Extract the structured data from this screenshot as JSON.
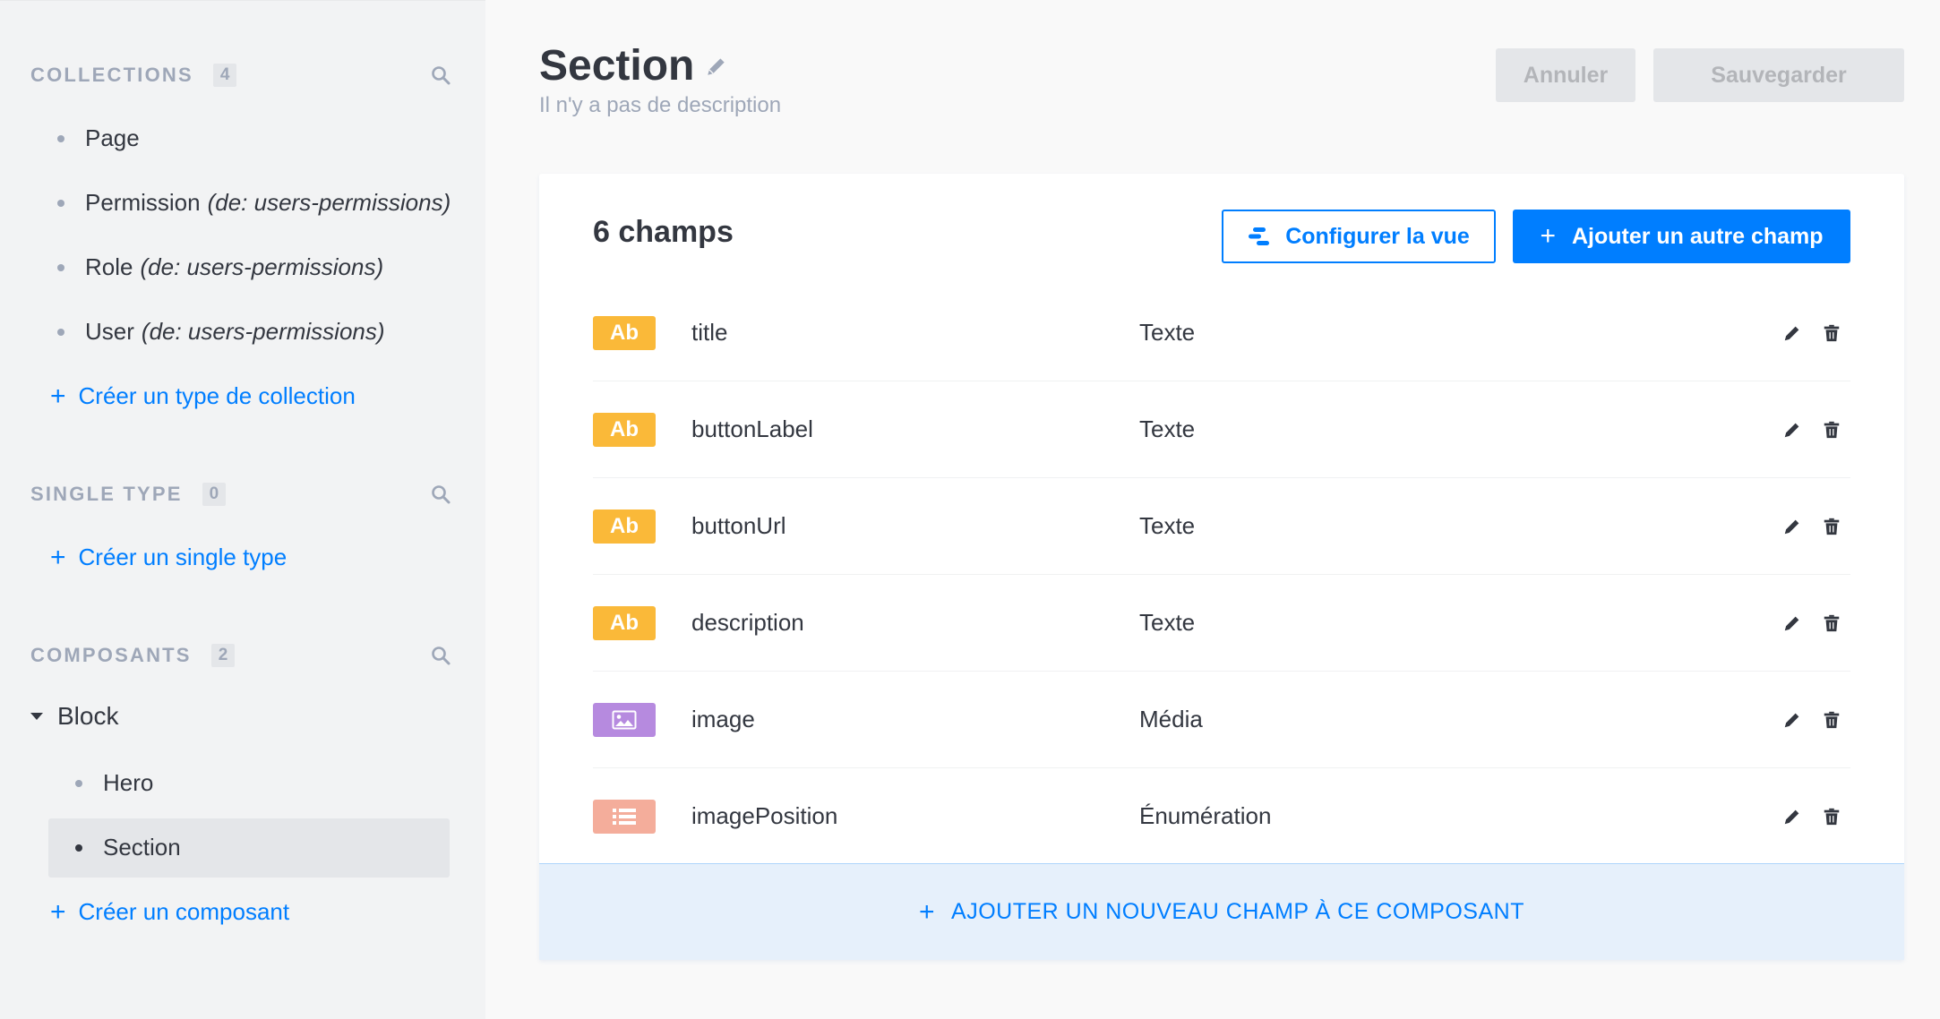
{
  "sidebar": {
    "collections": {
      "title": "Collections",
      "count": "4",
      "items": [
        {
          "label": "Page",
          "origin": ""
        },
        {
          "label": "Permission",
          "origin": "(de: users-permissions)"
        },
        {
          "label": "Role",
          "origin": "(de: users-permissions)"
        },
        {
          "label": "User",
          "origin": "(de: users-permissions)"
        }
      ],
      "create_label": "Créer un type de collection"
    },
    "single_type": {
      "title": "Single Type",
      "count": "0",
      "create_label": "Créer un single type"
    },
    "components": {
      "title": "Composants",
      "count": "2",
      "group_label": "Block",
      "items": [
        {
          "label": "Hero"
        },
        {
          "label": "Section"
        }
      ],
      "create_label": "Créer un composant"
    }
  },
  "header": {
    "title": "Section",
    "description": "Il n'y a pas de description",
    "cancel_label": "Annuler",
    "save_label": "Sauvegarder"
  },
  "card": {
    "count_label": "6 champs",
    "config_label": "Configurer la vue",
    "add_label": "Ajouter un autre champ",
    "add_component_field_label": "AJOUTER UN NOUVEAU CHAMP À CE COMPOSANT",
    "fields": [
      {
        "badge": "Ab",
        "badge_kind": "text",
        "name": "title",
        "type": "Texte"
      },
      {
        "badge": "Ab",
        "badge_kind": "text",
        "name": "buttonLabel",
        "type": "Texte"
      },
      {
        "badge": "Ab",
        "badge_kind": "text",
        "name": "buttonUrl",
        "type": "Texte"
      },
      {
        "badge": "Ab",
        "badge_kind": "text",
        "name": "description",
        "type": "Texte"
      },
      {
        "badge": "",
        "badge_kind": "media",
        "name": "image",
        "type": "Média"
      },
      {
        "badge": "",
        "badge_kind": "enum",
        "name": "imagePosition",
        "type": "Énumération"
      }
    ]
  },
  "icons": {
    "search": "search-icon",
    "pencil": "pencil-icon",
    "trash": "trash-icon",
    "plus": "plus-icon",
    "config": "layout-config-icon",
    "media": "image-icon",
    "enum": "list-icon",
    "caret": "caret-down-icon"
  },
  "colors": {
    "accent": "#007eff",
    "text_badge": "#fab939",
    "media_badge": "#b68adf",
    "enum_badge": "#f4ad9b",
    "sidebar_bg": "#f2f3f4"
  }
}
